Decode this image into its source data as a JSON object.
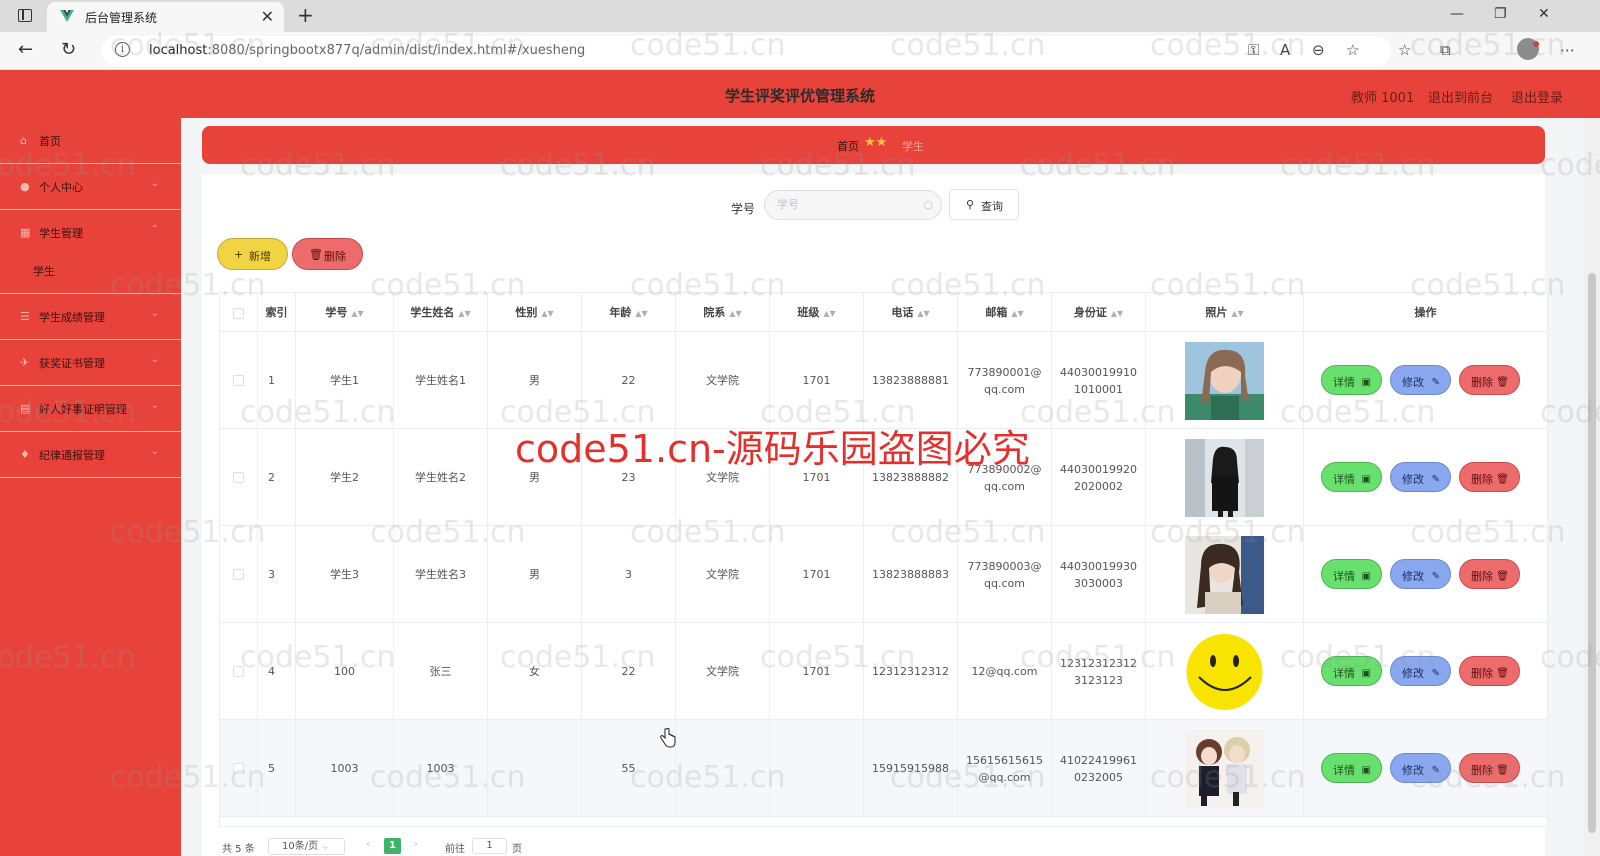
{
  "browser": {
    "tab_title": "后台管理系统",
    "url_host": "localhost",
    "url_rest": ":8080/springbootx877q/admin/dist/index.html#/xuesheng"
  },
  "header": {
    "title": "学生评奖评优管理系统",
    "user": "教师 1001",
    "to_front": "退出到前台",
    "logout": "退出登录"
  },
  "sidebar": {
    "items": [
      {
        "label": "首页",
        "icon": "home-icon"
      },
      {
        "label": "个人中心",
        "icon": "user-icon"
      },
      {
        "label": "学生管理",
        "icon": "grid-icon"
      },
      {
        "label": "学生",
        "icon": ""
      },
      {
        "label": "学生成绩管理",
        "icon": "list-icon"
      },
      {
        "label": "获奖证书管理",
        "icon": "award-icon"
      },
      {
        "label": "好人好事证明管理",
        "icon": "document-icon"
      },
      {
        "label": "纪律通报管理",
        "icon": "bell-icon"
      }
    ]
  },
  "breadcrumb": {
    "home": "首页",
    "current": "学生"
  },
  "search": {
    "label": "学号",
    "placeholder": "学号",
    "button": "查询"
  },
  "actions": {
    "add": "新增",
    "delete": "删除"
  },
  "table": {
    "columns": [
      "索引",
      "学号",
      "学生姓名",
      "性别",
      "年龄",
      "院系",
      "班级",
      "电话",
      "邮箱",
      "身份证",
      "照片",
      "操作"
    ],
    "rows": [
      {
        "index": "1",
        "xuehao": "学生1",
        "name": "学生姓名1",
        "sex": "男",
        "age": "22",
        "dept": "文学院",
        "cls": "1701",
        "phone": "13823888881",
        "email": "773890001@qq.com",
        "idcard": "440300199101010001",
        "photo": "portrait-1"
      },
      {
        "index": "2",
        "xuehao": "学生2",
        "name": "学生姓名2",
        "sex": "男",
        "age": "23",
        "dept": "文学院",
        "cls": "1701",
        "phone": "13823888882",
        "email": "773890002@qq.com",
        "idcard": "440300199202020002",
        "photo": "portrait-2"
      },
      {
        "index": "3",
        "xuehao": "学生3",
        "name": "学生姓名3",
        "sex": "男",
        "age": "3",
        "dept": "文学院",
        "cls": "1701",
        "phone": "13823888883",
        "email": "773890003@qq.com",
        "idcard": "440300199303030003",
        "photo": "portrait-3"
      },
      {
        "index": "4",
        "xuehao": "100",
        "name": "张三",
        "sex": "女",
        "age": "22",
        "dept": "文学院",
        "cls": "1701",
        "phone": "12312312312",
        "email": "12@qq.com",
        "idcard": "123123123123123123",
        "photo": "smiley"
      },
      {
        "index": "5",
        "xuehao": "1003",
        "name": "1003",
        "sex": "",
        "age": "55",
        "dept": "",
        "cls": "",
        "phone": "15915915988",
        "email": "15615615615@qq.com",
        "idcard": "410224199610232005",
        "photo": "anime"
      }
    ],
    "op_detail": "详情",
    "op_edit": "修改",
    "op_delete": "删除"
  },
  "pager": {
    "total": "共 5 条",
    "size": "10条/页",
    "current": "1",
    "goto": "前往",
    "goto_value": "1",
    "unit": "页"
  },
  "watermark": {
    "small": "code51.cn",
    "big": "code51.cn-源码乐园盗图必究"
  },
  "colors": {
    "primary_red": "#e8433b",
    "detail_green": "#67e06d",
    "edit_blue": "#8aa8ef",
    "delete_red": "#ee6b6b",
    "add_yellow": "#f0d442",
    "page_green": "#40b36b"
  }
}
